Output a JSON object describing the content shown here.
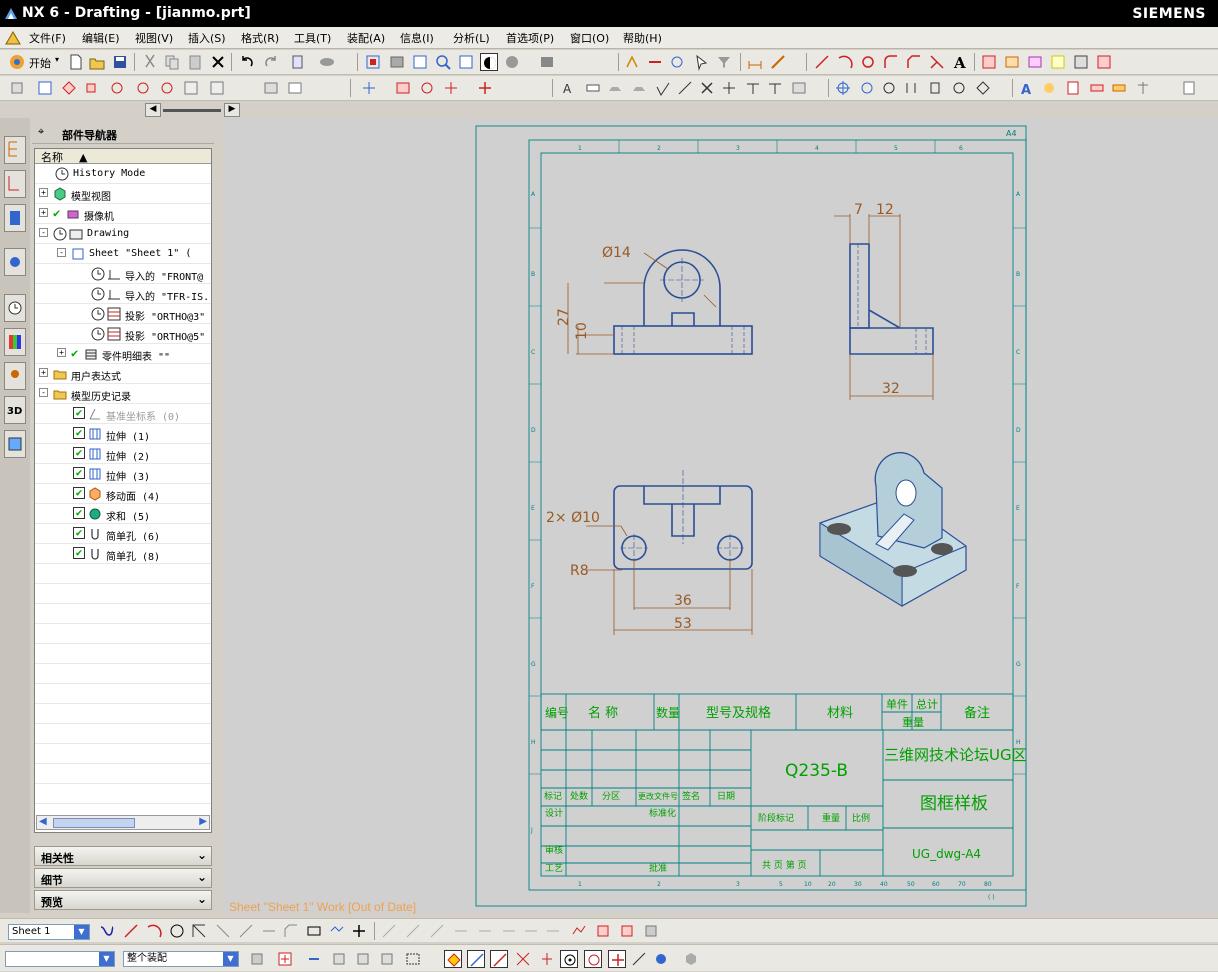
{
  "window": {
    "title": "NX 6 - Drafting - [jianmo.prt]",
    "brand": "SIEMENS"
  },
  "menu": [
    "文件(F)",
    "编辑(E)",
    "视图(V)",
    "插入(S)",
    "格式(R)",
    "工具(T)",
    "装配(A)",
    "信息(I)",
    "分析(L)",
    "首选项(P)",
    "窗口(O)",
    "帮助(H)"
  ],
  "toolbar": {
    "start_label": "开始"
  },
  "navigator": {
    "title": "部件导航器",
    "column_header": "名称",
    "items": [
      {
        "label": "History Mode"
      },
      {
        "label": "模型视图"
      },
      {
        "label": "摄像机"
      },
      {
        "label": "Drawing"
      },
      {
        "label": "Sheet \"Sheet 1\" ("
      },
      {
        "label": "导入的 \"FRONT@"
      },
      {
        "label": "导入的 \"TFR-IS."
      },
      {
        "label": "投影 \"ORTHO@3\""
      },
      {
        "label": "投影 \"ORTHO@5\""
      },
      {
        "label": "零件明细表 \"\""
      },
      {
        "label": "用户表达式"
      },
      {
        "label": "模型历史记录"
      },
      {
        "label": "基准坐标系 (0)"
      },
      {
        "label": "拉伸 (1)"
      },
      {
        "label": "拉伸 (2)"
      },
      {
        "label": "拉伸 (3)"
      },
      {
        "label": "移动面 (4)"
      },
      {
        "label": "求和 (5)"
      },
      {
        "label": "简单孔 (6)"
      },
      {
        "label": "简单孔 (8)"
      }
    ],
    "panels": [
      "相关性",
      "细节",
      "预览"
    ]
  },
  "drawing": {
    "sheet_label": "A4",
    "dims": {
      "d14": "Ø14",
      "d27": "27",
      "d10": "10",
      "d7": "7",
      "d12": "12",
      "d32": "32",
      "hole": "2× Ø10",
      "r8": "R8",
      "d36": "36",
      "d53": "53"
    },
    "title_block": {
      "h_num": "编号",
      "h_name": "名  称",
      "h_qty": "数量",
      "h_model": "型号及规格",
      "h_mat": "材料",
      "h_unit": "单件",
      "h_total": "总计",
      "h_weight": "重量",
      "h_note": "备注",
      "material": "Q235-B",
      "company": "三维网技术论坛UG区",
      "drawing_name": "图框样板",
      "drawing_no": "UG_dwg-A4",
      "r_mark": "标记",
      "r_cnt": "处数",
      "r_zone": "分区",
      "r_doc": "更改文件号",
      "r_sign": "签名",
      "r_date": "日期",
      "design": "设计",
      "std": "标准化",
      "stage": "阶段标记",
      "wt": "重量",
      "scale": "比例",
      "review": "审核",
      "craft": "工艺",
      "approve": "批准",
      "sheets": "共  页  第  页"
    }
  },
  "status": {
    "message": "Sheet \"Sheet 1\" Work [Out of Date]"
  },
  "bottom": {
    "sheet_value": "Sheet 1",
    "assembly_filter": "整个装配"
  }
}
